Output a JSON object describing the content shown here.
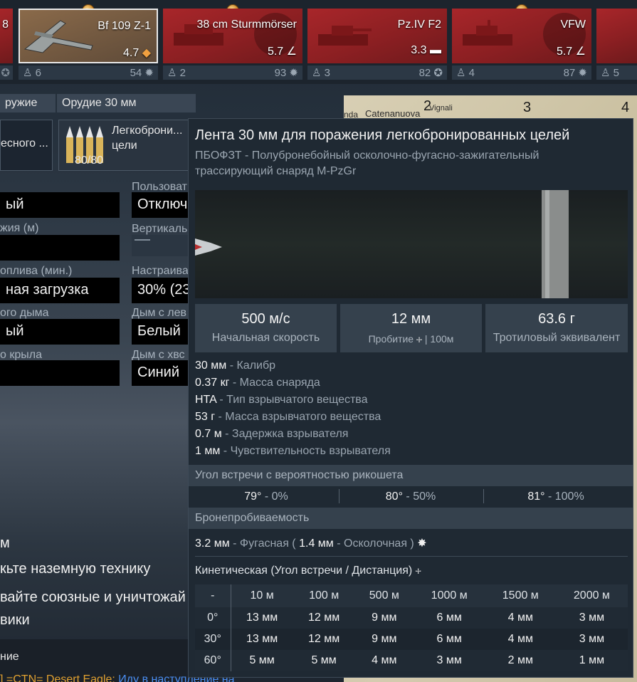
{
  "unit_bar": {
    "slots": [
      {
        "name": "",
        "br": "8",
        "crew": "",
        "rank": ""
      },
      {
        "name": "Bf 109 Z-1",
        "br": "4.7",
        "crew": "6",
        "rank": "54"
      },
      {
        "name": "38 cm Sturmmörser",
        "br": "5.7",
        "crew": "2",
        "rank": "93"
      },
      {
        "name": "Pz.IV F2",
        "br": "3.3",
        "crew": "3",
        "rank": "82"
      },
      {
        "name": "VFW",
        "br": "5.7",
        "crew": "4",
        "rank": "87"
      },
      {
        "name": "",
        "br": "",
        "crew": "5",
        "rank": ""
      }
    ]
  },
  "settings_panel": {
    "tabs": [
      "ружие",
      "Орудие 30 мм"
    ],
    "ammo_left_label": "есного ...",
    "ammo_label": "Легкоброни... цели",
    "ammo_count": "80/80",
    "left_labels": [
      "жия (м)",
      "оплива (мин.)",
      "ого дыма",
      "о крыла"
    ],
    "left_values": [
      "ый",
      "",
      "ная загрузка",
      "ый",
      ""
    ],
    "right_labels": [
      "Пользоват",
      "Вертикаль",
      "Настраива",
      "Дым с лев",
      "Дым с хвс"
    ],
    "right_values": [
      "Отключ",
      "30% (23",
      "Белый",
      "Синий"
    ],
    "mission_lines": [
      "м",
      "кьте наземную технику",
      "вайте союзные и уничтожай",
      "вики"
    ],
    "chat_header": "ние",
    "chat_line_prefix": "] =CTN= Desert Eagle:",
    "chat_line_text": "Иду в наступление на"
  },
  "map": {
    "places": [
      "nda",
      "Catenanuova",
      "Vignali"
    ],
    "grid_numbers": [
      "2",
      "3",
      "4"
    ]
  },
  "tooltip": {
    "title": "Лента 30 мм для поражения легкобронированных целей",
    "subtitle": "ПБОФЗТ - Полубронебойный осколочно-фугасно-зажигательный трассирующий снаряд M-PzGr",
    "stats": [
      {
        "value": "500 м/с",
        "label": "Начальная скорость"
      },
      {
        "value": "12 мм",
        "label": "Пробитие",
        "label_suffix": "| 100м"
      },
      {
        "value": "63.6 г",
        "label": "Тротиловый эквивалент"
      }
    ],
    "properties": [
      {
        "value": "30 мм",
        "label": "- Калибр"
      },
      {
        "value": "0.37 кг",
        "label": "- Масса снаряда"
      },
      {
        "value": "HTA",
        "label": "- Тип взрывчатого вещества"
      },
      {
        "value": "53 г",
        "label": "- Масса взрывчатого вещества"
      },
      {
        "value": "0.7 м",
        "label": "- Задержка взрывателя"
      },
      {
        "value": "1 мм",
        "label": "- Чувствительность взрывателя"
      }
    ],
    "ricochet": {
      "header": "Угол встречи с вероятностью рикошета",
      "items": [
        {
          "angle": "79°",
          "prob": "- 0%"
        },
        {
          "angle": "80°",
          "prob": "- 50%"
        },
        {
          "angle": "81°",
          "prob": "- 100%"
        }
      ]
    },
    "penetration": {
      "header": "Бронепробиваемость",
      "he_value": "3.2 мм",
      "he_label": "- Фугасная (",
      "frag_value": "1.4 мм",
      "frag_label": "- Осколочная )",
      "kinetic_title": "Кинетическая (Угол встречи / Дистанция)",
      "table_corner": "-",
      "distances": [
        "10 м",
        "100 м",
        "500 м",
        "1000 м",
        "1500 м",
        "2000 м"
      ],
      "rows": [
        {
          "angle": "0°",
          "values": [
            "13 мм",
            "12 мм",
            "9 мм",
            "6 мм",
            "4 мм",
            "3 мм"
          ]
        },
        {
          "angle": "30°",
          "values": [
            "13 мм",
            "12 мм",
            "9 мм",
            "6 мм",
            "4 мм",
            "3 мм"
          ]
        },
        {
          "angle": "60°",
          "values": [
            "5 мм",
            "5 мм",
            "4 мм",
            "3 мм",
            "2 мм",
            "1 мм"
          ]
        }
      ]
    }
  },
  "colors": {
    "unit_red": "#a8262a",
    "tooltip_bg": "#1f2933",
    "section_bg": "#35414d",
    "chat_name": "#e0a030",
    "chat_text": "#4a8df0"
  }
}
